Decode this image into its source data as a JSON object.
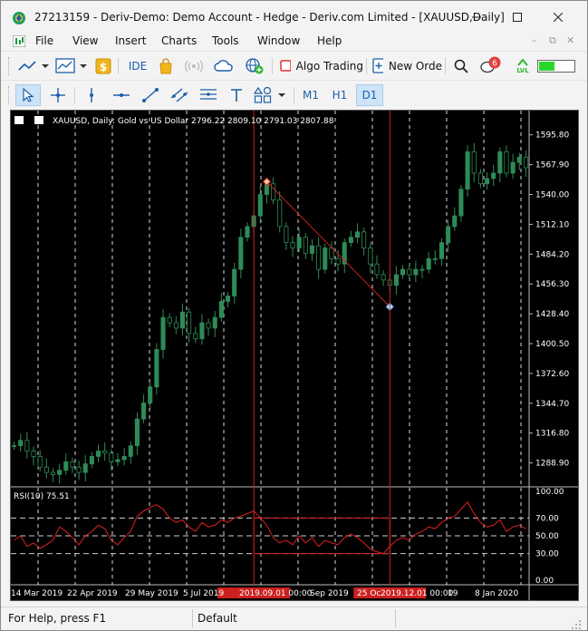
{
  "window": {
    "title": "27213159 - Deriv-Demo: Demo Account - Hedge - Deriv.com Limited - [XAUUSD,Daily]",
    "controls": [
      "minimize",
      "maximize",
      "close"
    ]
  },
  "menu": {
    "items": [
      "File",
      "View",
      "Insert",
      "Charts",
      "Tools",
      "Window",
      "Help"
    ]
  },
  "toolbar": {
    "ide_label": "IDE",
    "algo_trading_label": "Algo Trading",
    "new_order_label": "New Orde",
    "notification_count": "6",
    "signal_label": "LVL",
    "accent_green": "#2bb52b"
  },
  "toolbar2": {
    "timeframes": [
      "M1",
      "H1",
      "D1"
    ],
    "active_timeframe": "D1"
  },
  "chart": {
    "header": "XAUUSD, Daily:  Gold vs US Dollar  2796.22 2809.10 2791.03 2807.88",
    "rsi_label": "RSI(10) 75.51",
    "price_ticks": [
      "1595.80",
      "1567.90",
      "1540.00",
      "1512.10",
      "1484.20",
      "1456.30",
      "1428.40",
      "1400.50",
      "1372.60",
      "1344.70",
      "1316.80",
      "1288.90"
    ],
    "rsi_ticks": [
      "100.00",
      "70.00",
      "50.00",
      "30.00",
      "0.00"
    ],
    "date_ticks": [
      "14 Mar 2019",
      "22 Apr 2019",
      "29 May 2019",
      "5 Jul 2019",
      "2019.09.01 00:00",
      "Sep 2019",
      "25 Oc",
      "2019.12.01 00:00",
      "19",
      "8 Jan 2020"
    ],
    "candle_color": "#2e8b57",
    "rsi_color": "#e02020",
    "marker_color": "#cc2020"
  },
  "chart_data": {
    "type": "line",
    "title": "XAUUSD, Daily:  Gold vs US Dollar",
    "ylim": [
      1275,
      1610
    ],
    "rsi_ylim": [
      0,
      100
    ],
    "series": [
      {
        "values": [
          1305,
          1310,
          1300,
          1295,
          1285,
          1280,
          1278,
          1282,
          1290,
          1285,
          1280,
          1288,
          1295,
          1300,
          1298,
          1290,
          1292,
          1295,
          1305,
          1330,
          1345,
          1360,
          1395,
          1425,
          1420,
          1415,
          1430,
          1410,
          1405,
          1420,
          1415,
          1425,
          1440,
          1445,
          1470,
          1500,
          1510,
          1520,
          1540,
          1550,
          1535,
          1510,
          1495,
          1490,
          1500,
          1485,
          1492,
          1470,
          1490,
          1480,
          1475,
          1495,
          1500,
          1505,
          1490,
          1475,
          1465,
          1460,
          1455,
          1465,
          1470,
          1465,
          1470,
          1470,
          1480,
          1480,
          1495,
          1510,
          1520,
          1545,
          1580,
          1560,
          1550,
          1555,
          1560,
          1580,
          1560,
          1570,
          1575,
          1565
        ]
      },
      {
        "values": [
          45,
          50,
          38,
          42,
          36,
          40,
          45,
          60,
          55,
          48,
          40,
          50,
          55,
          62,
          58,
          45,
          40,
          48,
          55,
          72,
          78,
          82,
          85,
          80,
          70,
          65,
          68,
          60,
          55,
          65,
          60,
          62,
          68,
          65,
          70,
          72,
          75,
          78,
          70,
          62,
          48,
          42,
          45,
          40,
          50,
          42,
          48,
          38,
          45,
          42,
          40,
          48,
          52,
          48,
          42,
          35,
          32,
          30,
          38,
          45,
          48,
          45,
          52,
          55,
          60,
          58,
          65,
          70,
          72,
          80,
          88,
          75,
          65,
          60,
          62,
          68,
          55,
          60,
          62,
          58
        ]
      }
    ],
    "annotations": [
      {
        "type": "trendline",
        "x": [
          39,
          58
        ],
        "y": [
          1552,
          1435
        ]
      },
      {
        "type": "vertical_line",
        "x": 37,
        "label": "2019.09.01 00:00"
      },
      {
        "type": "vertical_line",
        "x": 58,
        "label": "2019.12.01 00:00"
      }
    ]
  },
  "status": {
    "help": "For Help, press F1",
    "profile": "Default"
  }
}
